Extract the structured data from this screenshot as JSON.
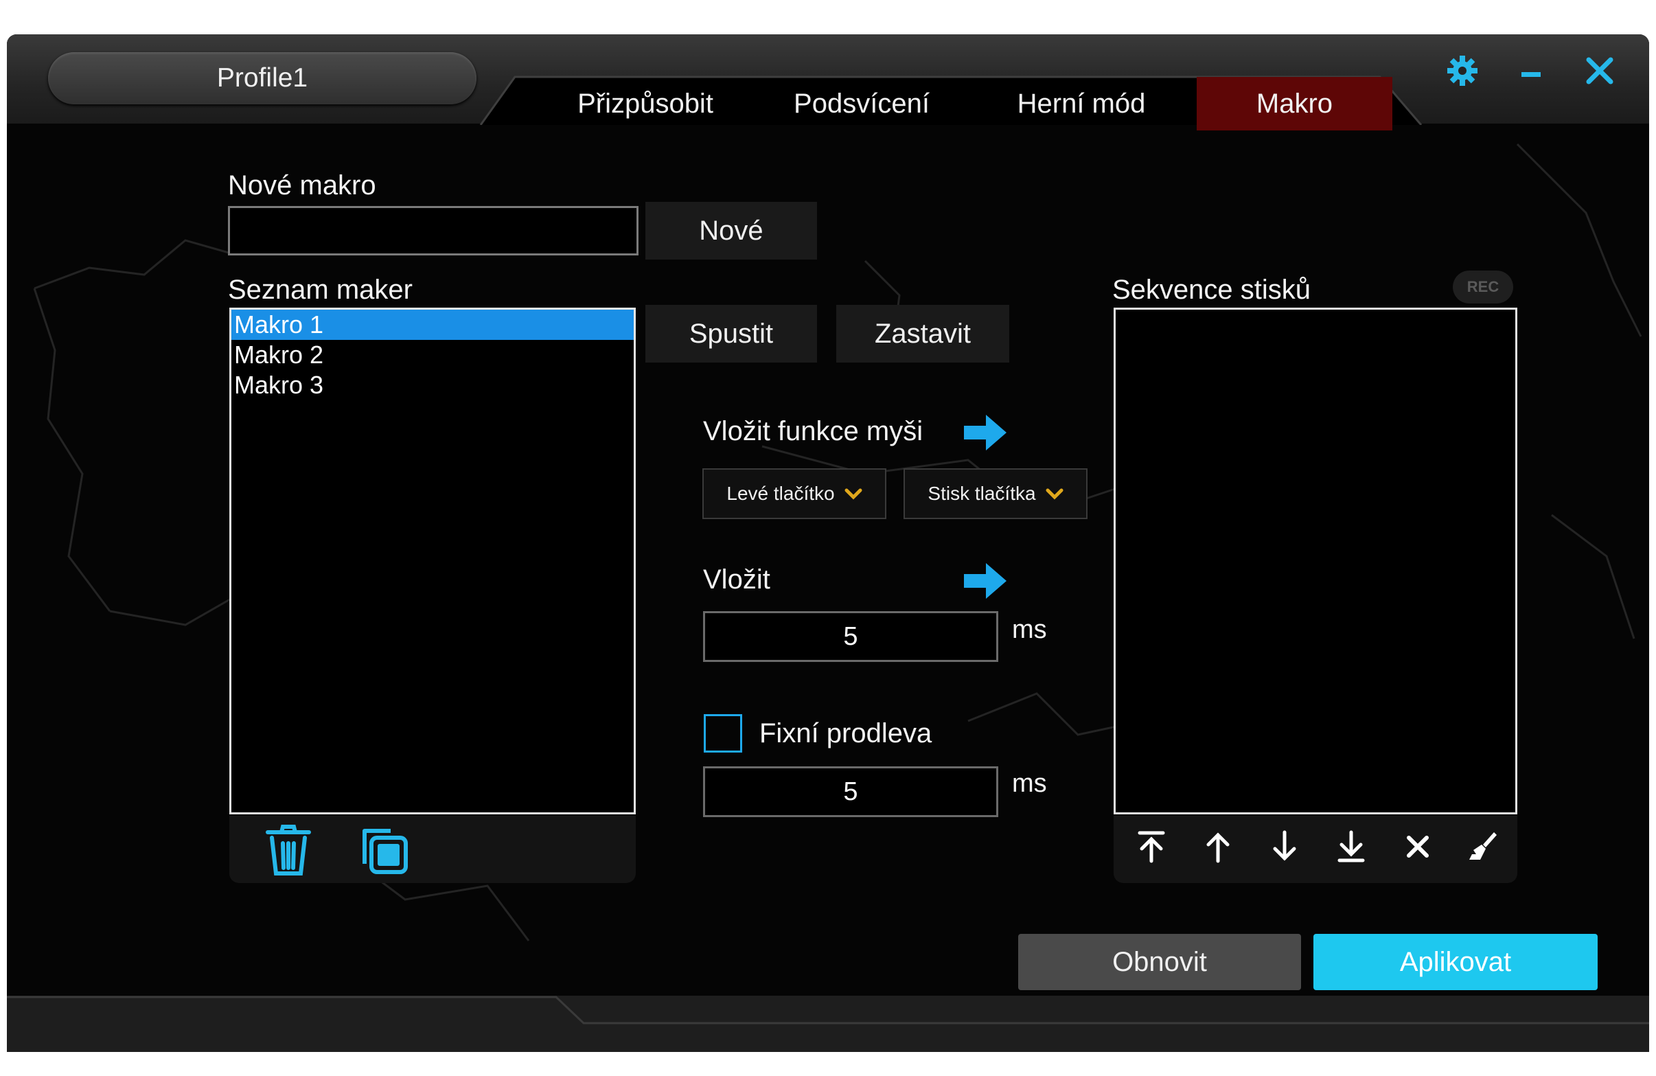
{
  "profile": {
    "name": "Profile1"
  },
  "tabs": [
    {
      "label": "Přizpůsobit",
      "active": false
    },
    {
      "label": "Podsvícení",
      "active": false
    },
    {
      "label": "Herní mód",
      "active": false
    },
    {
      "label": "Makro",
      "active": true
    }
  ],
  "window_controls": {
    "icons": [
      "gear-icon",
      "minimize-icon",
      "close-icon"
    ]
  },
  "new_macro": {
    "label": "Nové makro",
    "value": "",
    "button": "Nové"
  },
  "macro_list": {
    "label": "Seznam maker",
    "items": [
      "Makro 1",
      "Makro 2",
      "Makro 3"
    ],
    "selected_index": 0,
    "run_button": "Spustit",
    "stop_button": "Zastavit",
    "tool_icons": [
      "trash-icon",
      "copy-icon"
    ]
  },
  "mouse_function": {
    "label": "Vložit funkce myši",
    "button_select": "Levé tlačítko",
    "action_select": "Stisk tlačítka"
  },
  "insert_delay": {
    "label": "Vložit",
    "value": "5",
    "unit": "ms"
  },
  "fixed_delay": {
    "label": "Fixní prodleva",
    "checked": false,
    "value": "5",
    "unit": "ms"
  },
  "sequence": {
    "label": "Sekvence stisků",
    "rec_badge": "REC",
    "tool_icons": [
      "move-top-icon",
      "move-up-icon",
      "move-down-icon",
      "move-bottom-icon",
      "delete-icon",
      "clear-icon"
    ]
  },
  "footer": {
    "reset_button": "Obnovit",
    "apply_button": "Aplikovat"
  },
  "colors": {
    "accent": "#1ec8ef",
    "active_tab": "#5e0606",
    "selection": "#1a8fe6",
    "icon": "#26b8ea"
  }
}
